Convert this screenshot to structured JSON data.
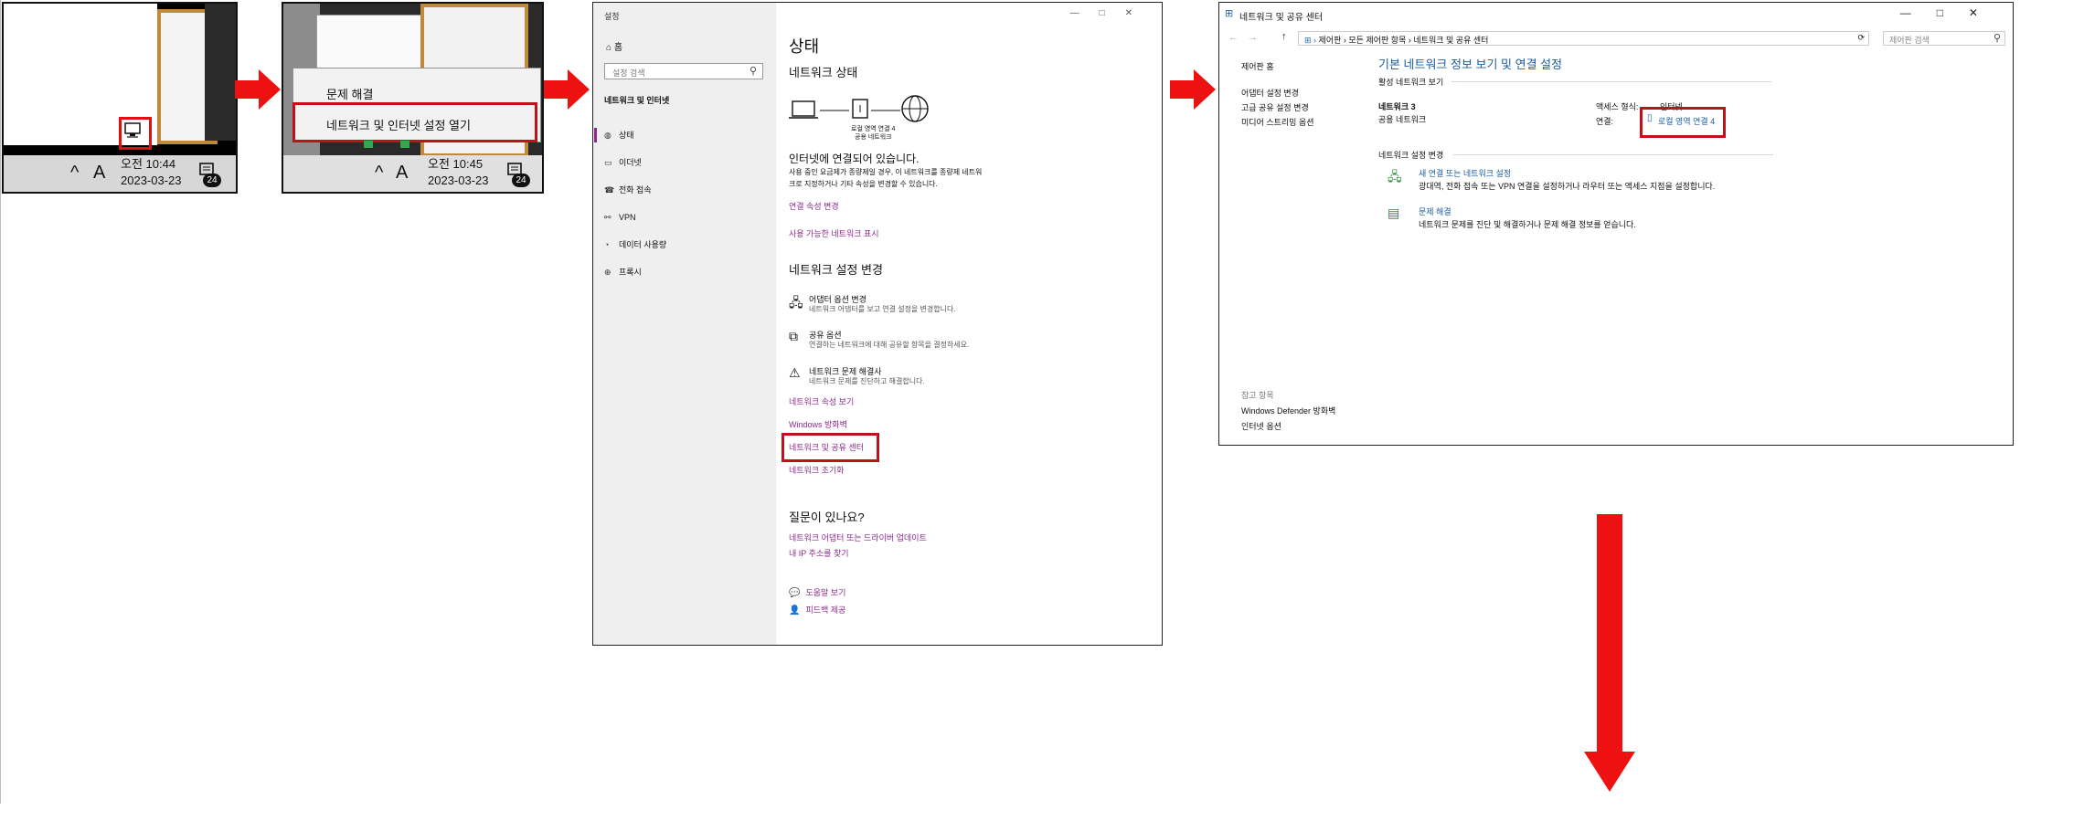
{
  "panel1": {
    "time": "오전 10:44",
    "date": "2023-03-23",
    "ime": "A",
    "notification_count": "24"
  },
  "panel2": {
    "context_menu": [
      "문제 해결",
      "네트워크 및 인터넷 설정 열기"
    ],
    "time": "오전 10:45",
    "date": "2023-03-23",
    "ime": "A",
    "notification_count": "24"
  },
  "settings": {
    "window_title": "설정",
    "home": "홈",
    "search_placeholder": "설정 검색",
    "category": "네트워크 및 인터넷",
    "nav": [
      "상태",
      "이더넷",
      "전화 접속",
      "VPN",
      "데이터 사용량",
      "프록시"
    ],
    "page_title": "상태",
    "network_status_heading": "네트워크 상태",
    "diagram_label_1": "로컬 영역 연결 4",
    "diagram_label_2": "공용 네트워크",
    "connected_text": "인터넷에 연결되어 있습니다.",
    "metered_text_1": "사용 중인 요금제가 종량제일 경우, 이 네트워크를 종량제 네트워",
    "metered_text_2": "크로 지정하거나 기타 속성을 변경할 수 있습니다.",
    "link_change_props": "연결 속성 변경",
    "link_show_networks": "사용 가능한 네트워크 표시",
    "change_settings_heading": "네트워크 설정 변경",
    "options": [
      {
        "title": "어댑터 옵션 변경",
        "desc": "네트워크 어댑터를 보고 연결 설정을 변경합니다."
      },
      {
        "title": "공유 옵션",
        "desc": "연결하는 네트워크에 대해 공유할 항목을 결정하세요."
      },
      {
        "title": "네트워크 문제 해결사",
        "desc": "네트워크 문제를 진단하고 해결합니다."
      }
    ],
    "link_view_props": "네트워크 속성 보기",
    "link_firewall": "Windows 방화벽",
    "link_sharing_center": "네트워크 및 공유 센터",
    "link_reset": "네트워크 초기화",
    "question_heading": "질문이 있나요?",
    "link_driver_update": "네트워크 어댑터 또는 드라이버 업데이트",
    "link_find_ip": "내 IP 주소를 찾기",
    "link_help": "도움말 보기",
    "link_feedback": "피드백 제공"
  },
  "control_panel": {
    "window_title": "네트워크 및 공유 센터",
    "breadcrumb": [
      "제어판",
      "모든 제어판 항목",
      "네트워크 및 공유 센터"
    ],
    "search_placeholder": "제어판 검색",
    "left_links": [
      "제어판 홈",
      "어댑터 설정 변경",
      "고급 공유 설정 변경",
      "미디어 스트리밍 옵션"
    ],
    "see_also": "참고 항목",
    "see_also_links": [
      "Windows Defender 방화벽",
      "인터넷 옵션"
    ],
    "heading": "기본 네트워크 정보 보기 및 연결 설정",
    "active_networks": "활성 네트워크 보기",
    "network_name": "네트워크 3",
    "network_type": "공용 네트워크",
    "access_type_label": "액세스 형식:",
    "access_type_value": "인터넷",
    "connection_label": "연결:",
    "connection_value": "로컬 영역 연결 4",
    "change_settings": "네트워크 설정 변경",
    "new_connection_title": "새 연결 또는 네트워크 설정",
    "new_connection_desc": "광대역, 전화 접속 또는 VPN 연결을 설정하거나 라우터 또는 액세스 지점을 설정합니다.",
    "troubleshoot_title": "문제 해결",
    "troubleshoot_desc": "네트워크 문제를 진단 및 해결하거나 문제 해결 정보를 얻습니다."
  },
  "colors": {
    "arrow": "#ee1111",
    "highlight": "#c0101a",
    "link_purple": "#8e2a8e",
    "link_blue": "#1b5c9f"
  }
}
